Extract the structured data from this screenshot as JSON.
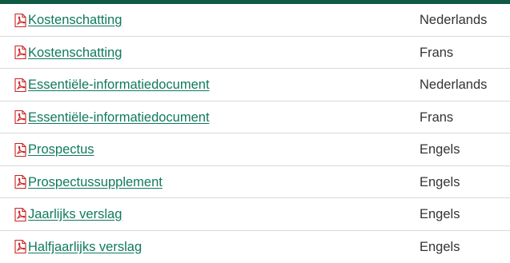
{
  "colors": {
    "top_bar": "#0f5a45",
    "link": "#0f7a5c",
    "text": "#333333",
    "divider": "#d9d9d9",
    "pdf_icon": "#cc2020"
  },
  "documents": [
    {
      "title": "Kostenschatting",
      "language": "Nederlands",
      "icon": "pdf-icon"
    },
    {
      "title": "Kostenschatting",
      "language": "Frans",
      "icon": "pdf-icon"
    },
    {
      "title": "Essentiële-informatiedocument",
      "language": "Nederlands",
      "icon": "pdf-icon"
    },
    {
      "title": "Essentiële-informatiedocument",
      "language": "Frans",
      "icon": "pdf-icon"
    },
    {
      "title": "Prospectus",
      "language": "Engels",
      "icon": "pdf-icon"
    },
    {
      "title": "Prospectussupplement",
      "language": "Engels",
      "icon": "pdf-icon"
    },
    {
      "title": "Jaarlijks verslag",
      "language": "Engels",
      "icon": "pdf-icon"
    },
    {
      "title": "Halfjaarlijks verslag",
      "language": "Engels",
      "icon": "pdf-icon"
    }
  ]
}
